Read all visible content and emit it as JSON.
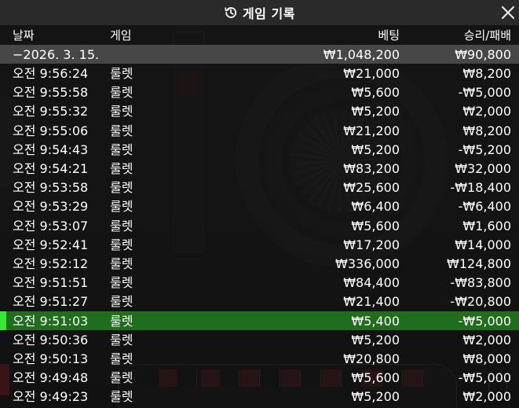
{
  "title": "게임 기록",
  "icons": {
    "history": "history-clock-icon",
    "close": "close-icon"
  },
  "colors": {
    "selected_row": "#1e6e1e",
    "selected_marker": "#37e637",
    "title_bar": "#2a2a2a"
  },
  "columns": {
    "date": "날짜",
    "game": "게임",
    "bet": "베팅",
    "winloss": "승리/패배"
  },
  "date_group": {
    "label": "−2026. 3. 15.",
    "bet_total": "₩1,048,200",
    "winloss_total": "₩90,800"
  },
  "rows": [
    {
      "time": "오전 9:56:24",
      "game": "룰렛",
      "bet": "₩21,000",
      "winloss": "₩8,200"
    },
    {
      "time": "오전 9:55:58",
      "game": "룰렛",
      "bet": "₩5,600",
      "winloss": "-₩5,000"
    },
    {
      "time": "오전 9:55:32",
      "game": "룰렛",
      "bet": "₩5,200",
      "winloss": "₩2,000"
    },
    {
      "time": "오전 9:55:06",
      "game": "룰렛",
      "bet": "₩21,200",
      "winloss": "₩8,200"
    },
    {
      "time": "오전 9:54:43",
      "game": "룰렛",
      "bet": "₩5,200",
      "winloss": "-₩5,200"
    },
    {
      "time": "오전 9:54:21",
      "game": "룰렛",
      "bet": "₩83,200",
      "winloss": "₩32,000"
    },
    {
      "time": "오전 9:53:58",
      "game": "룰렛",
      "bet": "₩25,600",
      "winloss": "-₩18,400"
    },
    {
      "time": "오전 9:53:29",
      "game": "룰렛",
      "bet": "₩6,400",
      "winloss": "-₩6,400"
    },
    {
      "time": "오전 9:53:07",
      "game": "룰렛",
      "bet": "₩5,600",
      "winloss": "₩1,600"
    },
    {
      "time": "오전 9:52:41",
      "game": "룰렛",
      "bet": "₩17,200",
      "winloss": "₩14,000"
    },
    {
      "time": "오전 9:52:12",
      "game": "룰렛",
      "bet": "₩336,000",
      "winloss": "₩124,800"
    },
    {
      "time": "오전 9:51:51",
      "game": "룰렛",
      "bet": "₩84,400",
      "winloss": "-₩83,800"
    },
    {
      "time": "오전 9:51:27",
      "game": "룰렛",
      "bet": "₩21,400",
      "winloss": "-₩20,800"
    },
    {
      "time": "오전 9:51:03",
      "game": "룰렛",
      "bet": "₩5,400",
      "winloss": "-₩5,000",
      "selected": true
    },
    {
      "time": "오전 9:50:36",
      "game": "룰렛",
      "bet": "₩5,200",
      "winloss": "₩2,000"
    },
    {
      "time": "오전 9:50:13",
      "game": "룰렛",
      "bet": "₩20,800",
      "winloss": "₩8,000"
    },
    {
      "time": "오전 9:49:48",
      "game": "룰렛",
      "bet": "₩5,600",
      "winloss": "-₩5,000"
    },
    {
      "time": "오전 9:49:23",
      "game": "룰렛",
      "bet": "₩5,200",
      "winloss": "₩2,000"
    }
  ]
}
